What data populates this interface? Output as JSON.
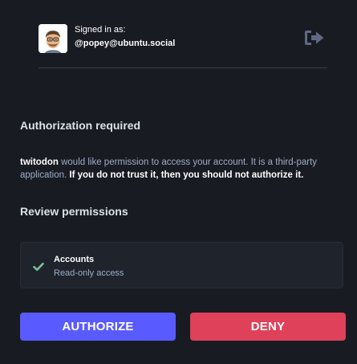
{
  "account": {
    "signed_in_label": "Signed in as:",
    "handle": "@popey@ubuntu.social",
    "avatar_icon": "memoji-avatar",
    "logout_icon": "sign-out-icon"
  },
  "auth": {
    "heading": "Authorization required",
    "app_name": "twitodon",
    "permission_text": " would like permission to access your account. It is a third-party application. ",
    "warning_text": "If you do not trust it, then you should not authorize it."
  },
  "review": {
    "heading": "Review permissions",
    "permissions": [
      {
        "title": "Accounts",
        "description": "Read-only access",
        "icon": "check-icon"
      }
    ]
  },
  "actions": {
    "authorize_label": "AUTHORIZE",
    "deny_label": "DENY"
  },
  "colors": {
    "background": "#191b22",
    "authorize": "#595aff",
    "deny": "#df405a",
    "check": "#79bd9a",
    "muted_text": "#9baec8"
  }
}
